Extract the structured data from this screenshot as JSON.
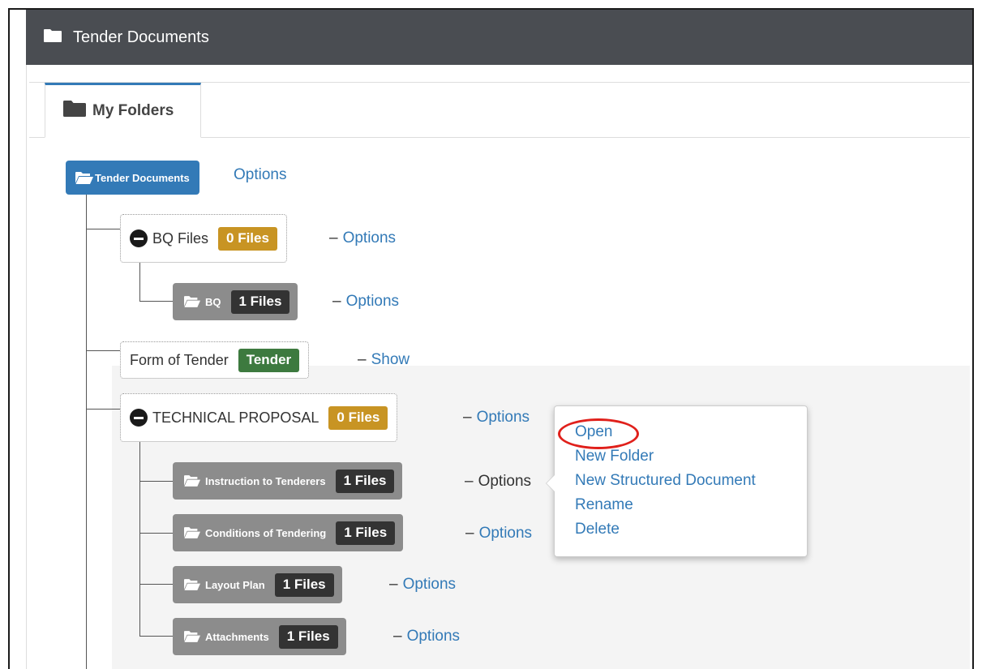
{
  "panel": {
    "title": "Tender Documents"
  },
  "tabs": [
    {
      "label": "My Folders"
    }
  ],
  "tree": {
    "root": {
      "label": "Tender Documents",
      "options": "Options"
    },
    "bq_files": {
      "label": "BQ Files",
      "badge": "0 Files",
      "options": "Options"
    },
    "bq": {
      "label": "BQ",
      "badge": "1 Files",
      "options": "Options"
    },
    "form_of_tender": {
      "label": "Form of Tender",
      "badge": "Tender",
      "show": "Show"
    },
    "technical_proposal": {
      "label": "TECHNICAL PROPOSAL",
      "badge": "0 Files",
      "options": "Options"
    },
    "instruction": {
      "label": "Instruction to Tenderers",
      "badge": "1 Files",
      "options": "Options"
    },
    "conditions": {
      "label": "Conditions of Tendering",
      "badge": "1 Files",
      "options": "Options"
    },
    "layout_plan": {
      "label": "Layout Plan",
      "badge": "1 Files",
      "options": "Options"
    },
    "attachments": {
      "label": "Attachments",
      "badge": "1 Files",
      "options": "Options"
    }
  },
  "dash": "–",
  "popover": {
    "items": [
      "Open",
      "New Folder",
      "New Structured Document",
      "Rename",
      "Delete"
    ]
  },
  "colors": {
    "header_bg": "#4a4d52",
    "primary": "#337ab7",
    "badge_orange": "#c89423",
    "badge_dark": "#333333",
    "badge_green": "#3d7a3f",
    "node_grey": "#8c8c8c",
    "annotation_red": "#e0201b"
  }
}
